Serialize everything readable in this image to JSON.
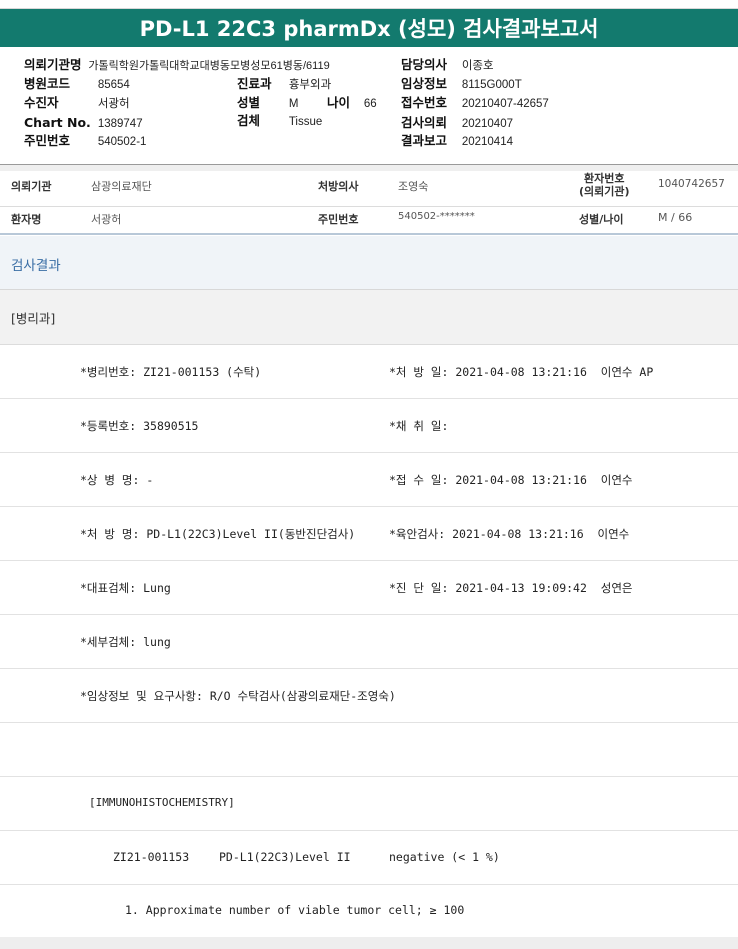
{
  "report": {
    "title": "PD-L1 22C3 pharmDx (성모) 검사결과보고서"
  },
  "summary": {
    "col1": [
      {
        "label": "의뢰기관명",
        "value": "가톨릭학원가톨릭대학교대병동모병성모61병동/6119"
      },
      {
        "label": "병원코드",
        "value": "85654"
      },
      {
        "label": "수진자",
        "value": "서광허"
      },
      {
        "label": "Chart No.",
        "value": "1389747"
      },
      {
        "label": "주민번호",
        "value": "540502-1"
      }
    ],
    "col2": [
      {
        "label": "진료과",
        "value": "흉부외과"
      },
      {
        "label": "성별",
        "value": "M"
      },
      {
        "label": "검체",
        "value": "Tissue"
      }
    ],
    "age": {
      "label": "나이",
      "value": "66"
    },
    "col3": [
      {
        "label": "담당의사",
        "value": "이종호"
      },
      {
        "label": "임상정보",
        "value": "8115G000T"
      },
      {
        "label": "접수번호",
        "value": "20210407-42657"
      },
      {
        "label": "검사의뢰",
        "value": "20210407"
      },
      {
        "label": "결과보고",
        "value": "20210414"
      }
    ]
  },
  "info": {
    "institution_label": "의뢰기관",
    "institution_value": "삼광의료재단",
    "doctor_label": "처방의사",
    "doctor_value": "조영숙",
    "patient_no_label_1": "환자번호",
    "patient_no_label_2": "(의뢰기관)",
    "patient_no_value": "1040742657",
    "patient_label": "환자명",
    "patient_value": "서광허",
    "ssn_label": "주민번호",
    "ssn_value": "540502-*******",
    "sex_age_label": "성별/나이",
    "sex_age_value": "M / 66"
  },
  "section": {
    "title": "검사결과",
    "department": "[병리과]"
  },
  "rows": [
    {
      "left": "*병리번호: ZI21-001153 (수탁)",
      "right": "*처 방 일: 2021-04-08 13:21:16  이연수 AP"
    },
    {
      "left": "*등록번호: 35890515",
      "right": "*채 취 일:"
    },
    {
      "left": "*상 병 명: -",
      "right": "*접 수 일: 2021-04-08 13:21:16  이연수"
    },
    {
      "left": "*처 방 명: PD-L1(22C3)Level II(동반진단검사)",
      "right": "*육안검사: 2021-04-08 13:21:16  이연수"
    },
    {
      "left": "*대표검체: Lung",
      "right": "*진 단 일: 2021-04-13 19:09:42  성연은"
    },
    {
      "left": "*세부검체: lung",
      "right": ""
    },
    {
      "left": "*임상정보 및 요구사항: R/O 수탁검사(삼광의료재단-조영숙)",
      "right": ""
    }
  ],
  "ihc": {
    "header": "[IMMUNOHISTOCHEMISTRY]",
    "case_no": "ZI21-001153",
    "test_name": "PD-L1(22C3)Level II",
    "result": "negative (< 1 %)",
    "note": "1. Approximate number of viable tumor cell; ≥ 100"
  }
}
